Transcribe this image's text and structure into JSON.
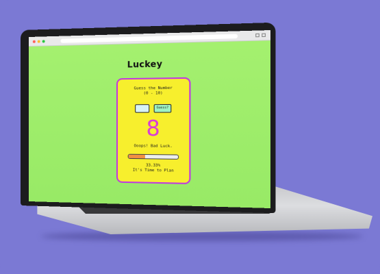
{
  "app": {
    "logo": "Luckey"
  },
  "game": {
    "prompt": "Guess the Number",
    "range": "(0 - 10)",
    "input_value": "",
    "button_label": "Guess?",
    "number": "8",
    "status": "Ooops! Bad Luck.",
    "progress_percent": 33.33,
    "progress_label": "33.33%",
    "message": "It's Time to Plan"
  },
  "colors": {
    "background": "#7b79d4",
    "screen": "#9ded6a",
    "card": "#f7ef2d",
    "card_border": "#c13adf",
    "number": "#d83bd8",
    "progress_fill": "#f19043"
  }
}
